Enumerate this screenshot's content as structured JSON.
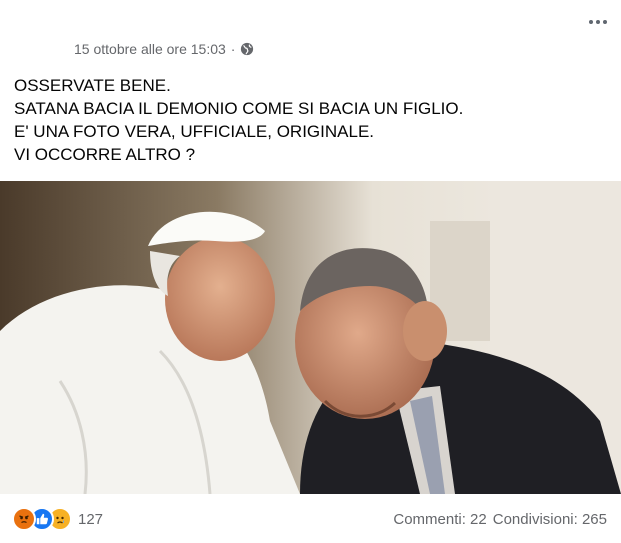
{
  "post": {
    "timestamp": "15 ottobre alle ore 15:03",
    "separator": "·",
    "audience_icon": "globe-icon",
    "more_icon": "more-options-icon",
    "lines": [
      "OSSERVATE BENE.",
      "SATANA BACIA IL DEMONIO COME SI BACIA UN FIGLIO.",
      "E' UNA FOTO VERA, UFFICIALE, ORIGINALE.",
      "VI OCCORRE ALTRO ?"
    ]
  },
  "footer": {
    "reaction_icons": [
      "angry-reaction-icon",
      "like-reaction-icon",
      "sad-reaction-icon"
    ],
    "reaction_count": "127",
    "comments": "Commenti: 22",
    "shares": "Condivisioni: 265"
  },
  "colors": {
    "text": "#050505",
    "meta": "#65676b",
    "angry": "#e9710f",
    "like": "#1877f2",
    "sad": "#f7b125"
  }
}
